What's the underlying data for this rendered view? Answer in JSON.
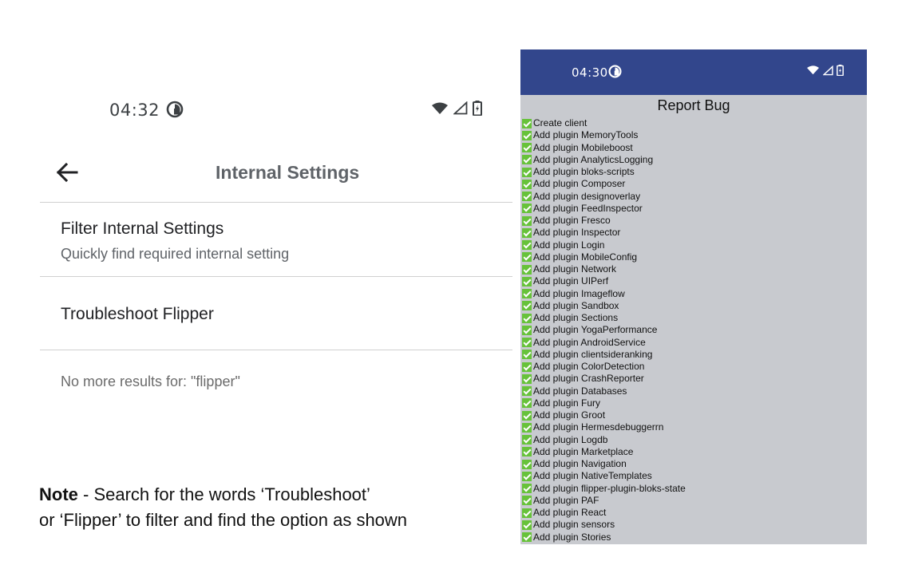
{
  "left": {
    "status": {
      "time": "04:32",
      "icons": [
        "media-status-icon",
        "wifi-icon",
        "signal-icon",
        "battery-icon"
      ]
    },
    "appbar": {
      "title": "Internal Settings",
      "back_icon": "arrow-back-icon"
    },
    "items": [
      {
        "title": "Filter Internal Settings",
        "subtitle": "Quickly find required internal setting"
      },
      {
        "title": "Troubleshoot Flipper"
      }
    ],
    "no_more_results": "No more results for: \"flipper\""
  },
  "note": {
    "label": "Note",
    "line1": " - Search for the words ‘Troubleshoot’",
    "line2": "or ‘Flipper’ to filter and find the option as shown"
  },
  "right": {
    "status": {
      "time": "04:30",
      "icons": [
        "media-status-icon",
        "wifi-icon",
        "signal-icon",
        "battery-icon"
      ]
    },
    "title": "Report Bug",
    "check_color": "#67c23a",
    "header_color": "#32468c",
    "items": [
      "Create client",
      "Add plugin MemoryTools",
      "Add plugin Mobileboost",
      "Add plugin AnalyticsLogging",
      "Add plugin bloks-scripts",
      "Add plugin Composer",
      "Add plugin designoverlay",
      "Add plugin FeedInspector",
      "Add plugin Fresco",
      "Add plugin Inspector",
      "Add plugin Login",
      "Add plugin MobileConfig",
      "Add plugin Network",
      "Add plugin UIPerf",
      "Add plugin Imageflow",
      "Add plugin Sandbox",
      "Add plugin Sections",
      "Add plugin YogaPerformance",
      "Add plugin AndroidService",
      "Add plugin clientsideranking",
      "Add plugin ColorDetection",
      "Add plugin CrashReporter",
      "Add plugin Databases",
      "Add plugin Fury",
      "Add plugin Groot",
      "Add plugin Hermesdebuggerrn",
      "Add plugin Logdb",
      "Add plugin Marketplace",
      "Add plugin Navigation",
      "Add plugin NativeTemplates",
      "Add plugin flipper-plugin-bloks-state",
      "Add plugin PAF",
      "Add plugin React",
      "Add plugin sensors",
      "Add plugin Stories"
    ]
  }
}
